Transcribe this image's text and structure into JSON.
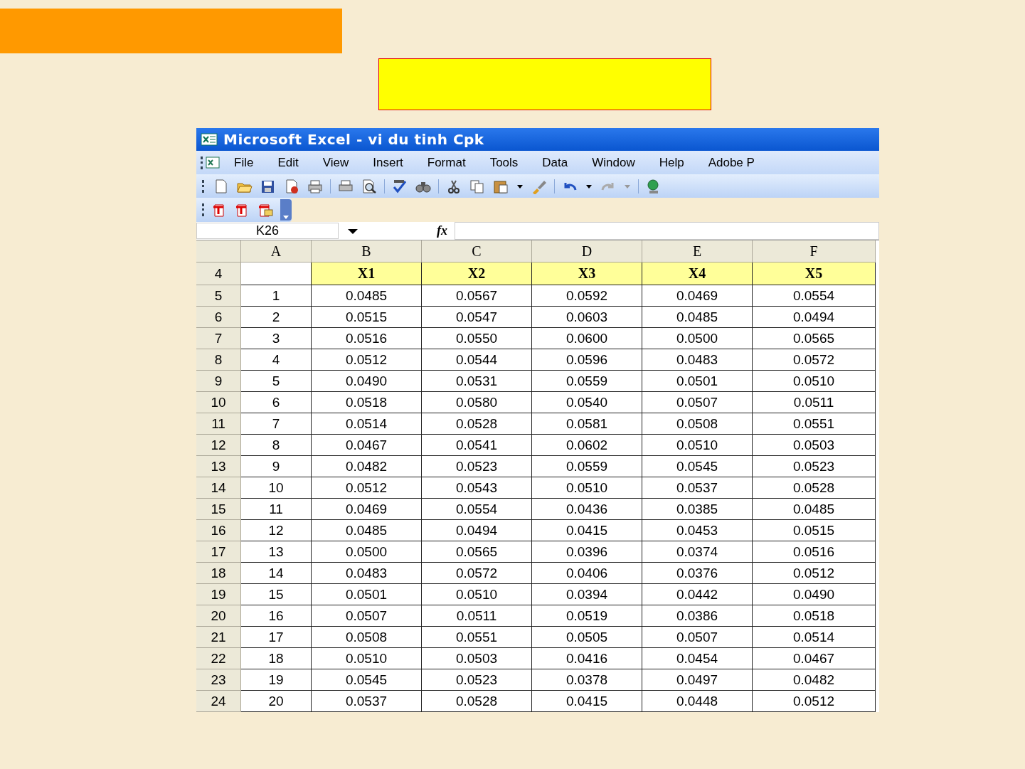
{
  "window": {
    "title": "Microsoft Excel - vi du tinh Cpk"
  },
  "menu": [
    "File",
    "Edit",
    "View",
    "Insert",
    "Format",
    "Tools",
    "Data",
    "Window",
    "Help",
    "Adobe P"
  ],
  "formula_bar": {
    "name_box": "K26",
    "fx": "fx"
  },
  "columns": [
    "A",
    "B",
    "C",
    "D",
    "E",
    "F"
  ],
  "header_row": {
    "row": "4",
    "cells": [
      "",
      "X1",
      "X2",
      "X3",
      "X4",
      "X5"
    ]
  },
  "rows": [
    {
      "row": "5",
      "cells": [
        "1",
        "0.0485",
        "0.0567",
        "0.0592",
        "0.0469",
        "0.0554"
      ]
    },
    {
      "row": "6",
      "cells": [
        "2",
        "0.0515",
        "0.0547",
        "0.0603",
        "0.0485",
        "0.0494"
      ]
    },
    {
      "row": "7",
      "cells": [
        "3",
        "0.0516",
        "0.0550",
        "0.0600",
        "0.0500",
        "0.0565"
      ]
    },
    {
      "row": "8",
      "cells": [
        "4",
        "0.0512",
        "0.0544",
        "0.0596",
        "0.0483",
        "0.0572"
      ]
    },
    {
      "row": "9",
      "cells": [
        "5",
        "0.0490",
        "0.0531",
        "0.0559",
        "0.0501",
        "0.0510"
      ]
    },
    {
      "row": "10",
      "cells": [
        "6",
        "0.0518",
        "0.0580",
        "0.0540",
        "0.0507",
        "0.0511"
      ]
    },
    {
      "row": "11",
      "cells": [
        "7",
        "0.0514",
        "0.0528",
        "0.0581",
        "0.0508",
        "0.0551"
      ]
    },
    {
      "row": "12",
      "cells": [
        "8",
        "0.0467",
        "0.0541",
        "0.0602",
        "0.0510",
        "0.0503"
      ]
    },
    {
      "row": "13",
      "cells": [
        "9",
        "0.0482",
        "0.0523",
        "0.0559",
        "0.0545",
        "0.0523"
      ]
    },
    {
      "row": "14",
      "cells": [
        "10",
        "0.0512",
        "0.0543",
        "0.0510",
        "0.0537",
        "0.0528"
      ]
    },
    {
      "row": "15",
      "cells": [
        "11",
        "0.0469",
        "0.0554",
        "0.0436",
        "0.0385",
        "0.0485"
      ]
    },
    {
      "row": "16",
      "cells": [
        "12",
        "0.0485",
        "0.0494",
        "0.0415",
        "0.0453",
        "0.0515"
      ]
    },
    {
      "row": "17",
      "cells": [
        "13",
        "0.0500",
        "0.0565",
        "0.0396",
        "0.0374",
        "0.0516"
      ]
    },
    {
      "row": "18",
      "cells": [
        "14",
        "0.0483",
        "0.0572",
        "0.0406",
        "0.0376",
        "0.0512"
      ]
    },
    {
      "row": "19",
      "cells": [
        "15",
        "0.0501",
        "0.0510",
        "0.0394",
        "0.0442",
        "0.0490"
      ]
    },
    {
      "row": "20",
      "cells": [
        "16",
        "0.0507",
        "0.0511",
        "0.0519",
        "0.0386",
        "0.0518"
      ]
    },
    {
      "row": "21",
      "cells": [
        "17",
        "0.0508",
        "0.0551",
        "0.0505",
        "0.0507",
        "0.0514"
      ]
    },
    {
      "row": "22",
      "cells": [
        "18",
        "0.0510",
        "0.0503",
        "0.0416",
        "0.0454",
        "0.0467"
      ]
    },
    {
      "row": "23",
      "cells": [
        "19",
        "0.0545",
        "0.0523",
        "0.0378",
        "0.0497",
        "0.0482"
      ]
    },
    {
      "row": "24",
      "cells": [
        "20",
        "0.0537",
        "0.0528",
        "0.0415",
        "0.0448",
        "0.0512"
      ]
    }
  ]
}
